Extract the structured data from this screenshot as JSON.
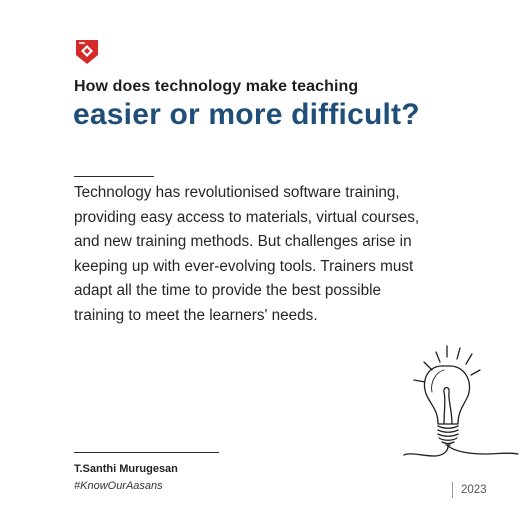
{
  "logo": {
    "icon": "red-shield-logo-icon",
    "brand_color": "#d42a2a"
  },
  "heading": {
    "kicker": "How does technology make teaching",
    "headline": "easier or more difficult?",
    "headline_color": "#1f4e79"
  },
  "body": {
    "lines": [
      "Technology has revolutionised software training,",
      "providing easy access to materials, virtual courses,",
      "and new training methods. But challenges arise in",
      "keeping up with ever-evolving tools. Trainers must",
      "adapt all the time to provide the best possible",
      "training to meet the learners' needs."
    ]
  },
  "illustration": {
    "icon": "lightbulb-sketch-icon"
  },
  "footer": {
    "author": "T.Santhi Murugesan",
    "hashtag": "#KnowOurAasans",
    "year": "2023"
  }
}
